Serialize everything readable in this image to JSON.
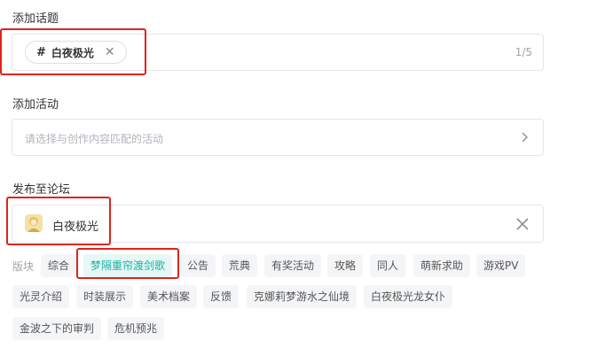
{
  "topic": {
    "label": "添加话题",
    "chip": {
      "hash": "#",
      "text": "白夜极光"
    },
    "counter": "1/5"
  },
  "activity": {
    "label": "添加活动",
    "placeholder": "请选择与创作内容匹配的活动"
  },
  "forum": {
    "label": "发布至论坛",
    "selected": "白夜极光"
  },
  "board": {
    "label": "版块",
    "tags": [
      "综合",
      "梦隔重帘渡剑歌",
      "公告",
      "荒典",
      "有奖活动",
      "攻略",
      "同人",
      "萌新求助",
      "游戏PV",
      "光灵介绍",
      "时装展示",
      "美术档案",
      "反馈",
      "克娜莉梦游水之仙境",
      "白夜极光龙女仆",
      "金波之下的审判",
      "危机预兆"
    ],
    "active_index": 1
  },
  "colors": {
    "accent": "#12b5a5",
    "highlight": "#e0231b"
  }
}
